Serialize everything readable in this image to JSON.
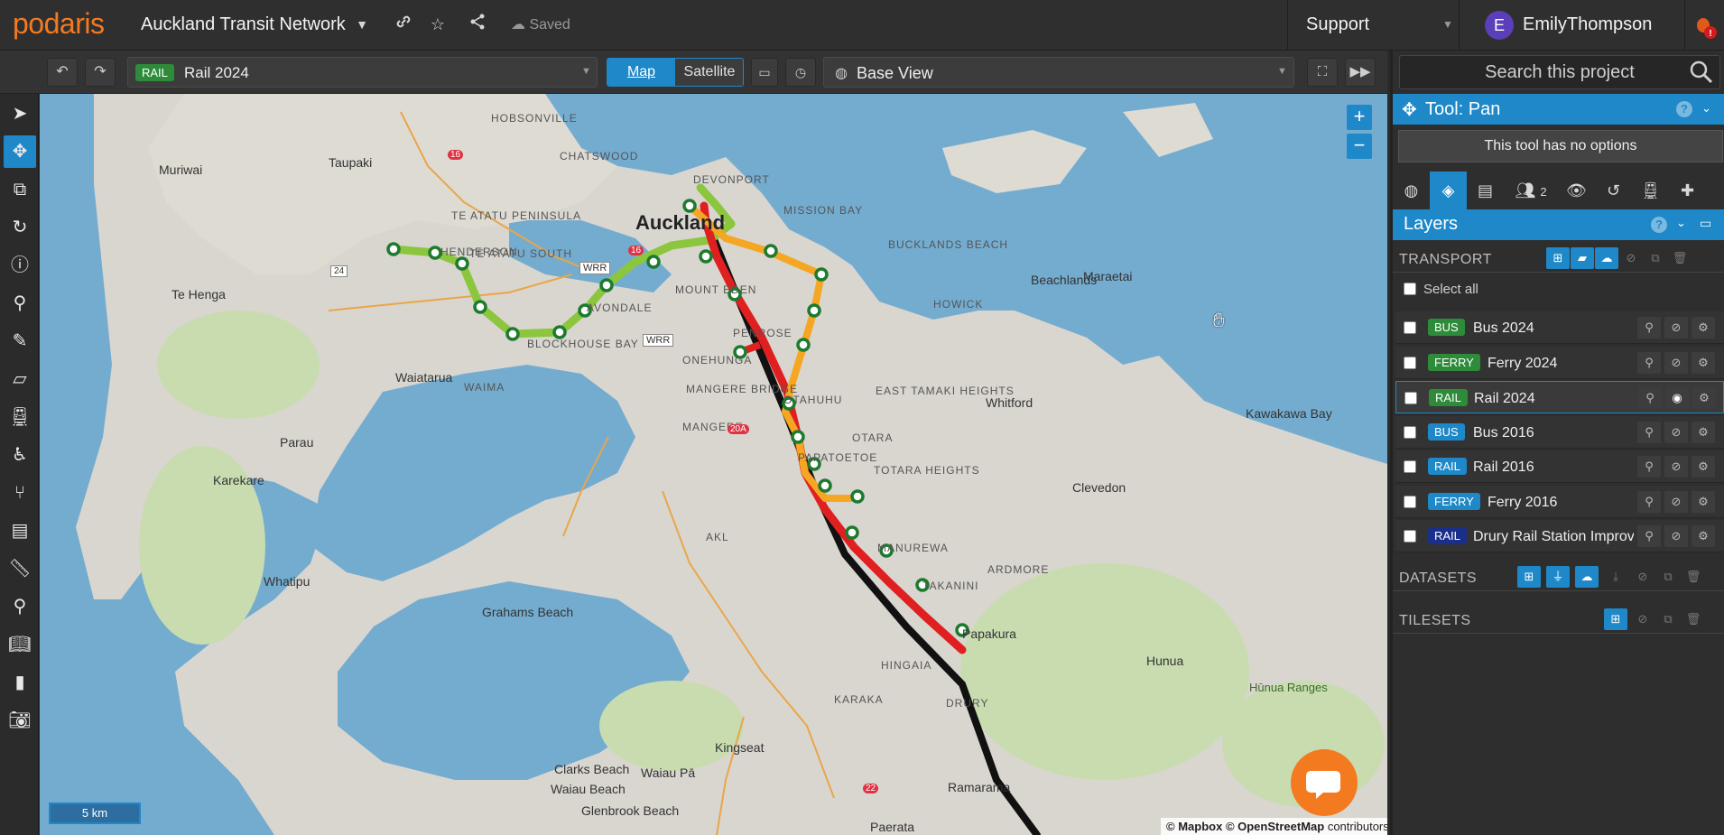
{
  "app": {
    "logo": "podaris",
    "project_title": "Auckland Transit Network",
    "saved_label": "Saved",
    "support_label": "Support",
    "user_initial": "E",
    "username": "EmilyThompson"
  },
  "toolbar": {
    "layer_badge": "RAIL",
    "layer_name": "Rail 2024",
    "map_label": "Map",
    "satellite_label": "Satellite",
    "base_view_label": "Base View"
  },
  "map": {
    "scale_label": "5 km",
    "attribution_mapbox": "© Mapbox",
    "attribution_osm": "© OpenStreetMap",
    "attribution_suffix": "contributors",
    "zoom_in": "+",
    "zoom_out": "−",
    "labels": {
      "auckland": "Auckland",
      "muriwai": "Muriwai",
      "taupaki": "Taupaki",
      "te_henga": "Te Henga",
      "waiatarua": "Waiatarua",
      "parau": "Parau",
      "karekare": "Karekare",
      "whatipu": "Whatipu",
      "grahams_beach": "Grahams Beach",
      "clarks_beach": "Clarks Beach",
      "waiau_beach": "Waiau Beach",
      "glenbrook_beach": "Glenbrook Beach",
      "waiau_pa": "Waiau Pā",
      "kingseat": "Kingseat",
      "paerata": "Paerata",
      "ramarama": "Ramarama",
      "hunua": "Hunua",
      "hunua_ranges": "Hūnua Ranges",
      "clevedon": "Clevedon",
      "kawakawa_bay": "Kawakawa Bay",
      "whitford": "Whitford",
      "beachlands": "Beachlands",
      "maraetai": "Maraetai",
      "papakura": "Papakura",
      "hobsonville": "HOBSONVILLE",
      "chatswood": "CHATSWOOD",
      "devonport": "DEVONPORT",
      "mission_bay": "MISSION BAY",
      "bucklands_beach": "BUCKLANDS BEACH",
      "howick": "HOWICK",
      "mount_eden": "MOUNT EDEN",
      "avondale": "AVONDALE",
      "henderson": "HENDERSON",
      "te_atatu_peninsula": "TE ATATU PENINSULA",
      "te_atatu_south": "TE ATATU SOUTH",
      "blockhouse_bay": "BLOCKHOUSE BAY",
      "waima": "WAIMA",
      "onehunga": "ONEHUNGA",
      "penrose": "PENROSE",
      "mangere_bridge": "MANGERE BRIDGE",
      "mangere": "MANGERE",
      "otahuhu": "OTAHUHU",
      "east_tamaki_heights": "EAST TAMAKI HEIGHTS",
      "otara": "OTARA",
      "papatoetoe": "PAPATOETOE",
      "totara_heights": "TOTARA HEIGHTS",
      "manurewa": "MANUREWA",
      "takanini": "TAKANINI",
      "ardmore": "ARDMORE",
      "hingaia": "HINGAIA",
      "karaka": "KARAKA",
      "drury": "DRURY",
      "akl": "AKL",
      "wrr": "WRR",
      "route_16": "16",
      "route_24": "24",
      "route_20a": "20A",
      "route_22": "22"
    }
  },
  "panel": {
    "search_placeholder": "Search this project",
    "tool_title": "Tool: Pan",
    "tool_options": "This tool has no options",
    "people_count": "2",
    "layers_title": "Layers",
    "sections": {
      "transport": "TRANSPORT",
      "datasets": "DATASETS",
      "tilesets": "TILESETS"
    },
    "select_all": "Select all",
    "layers": [
      {
        "badge": "BUS",
        "badge_color": "#2e8b3a",
        "name": "Bus 2024",
        "visible": false,
        "selected": false
      },
      {
        "badge": "FERRY",
        "badge_color": "#2e8b3a",
        "name": "Ferry 2024",
        "visible": false,
        "selected": false
      },
      {
        "badge": "RAIL",
        "badge_color": "#2e8b3a",
        "name": "Rail 2024",
        "visible": true,
        "selected": true
      },
      {
        "badge": "BUS",
        "badge_color": "#1e88c8",
        "name": "Bus 2016",
        "visible": false,
        "selected": false
      },
      {
        "badge": "RAIL",
        "badge_color": "#1e88c8",
        "name": "Rail 2016",
        "visible": false,
        "selected": false
      },
      {
        "badge": "FERRY",
        "badge_color": "#1e88c8",
        "name": "Ferry 2016",
        "visible": false,
        "selected": false
      },
      {
        "badge": "RAIL",
        "badge_color": "#1a2f8a",
        "name": "Drury Rail Station Improvements",
        "visible": false,
        "selected": false
      }
    ]
  },
  "colors": {
    "accent": "#1e88c8",
    "brand_orange": "#f47a20",
    "line_green": "#8cc63f",
    "line_red": "#e02020",
    "line_orange": "#f5a623",
    "line_black": "#111111"
  }
}
